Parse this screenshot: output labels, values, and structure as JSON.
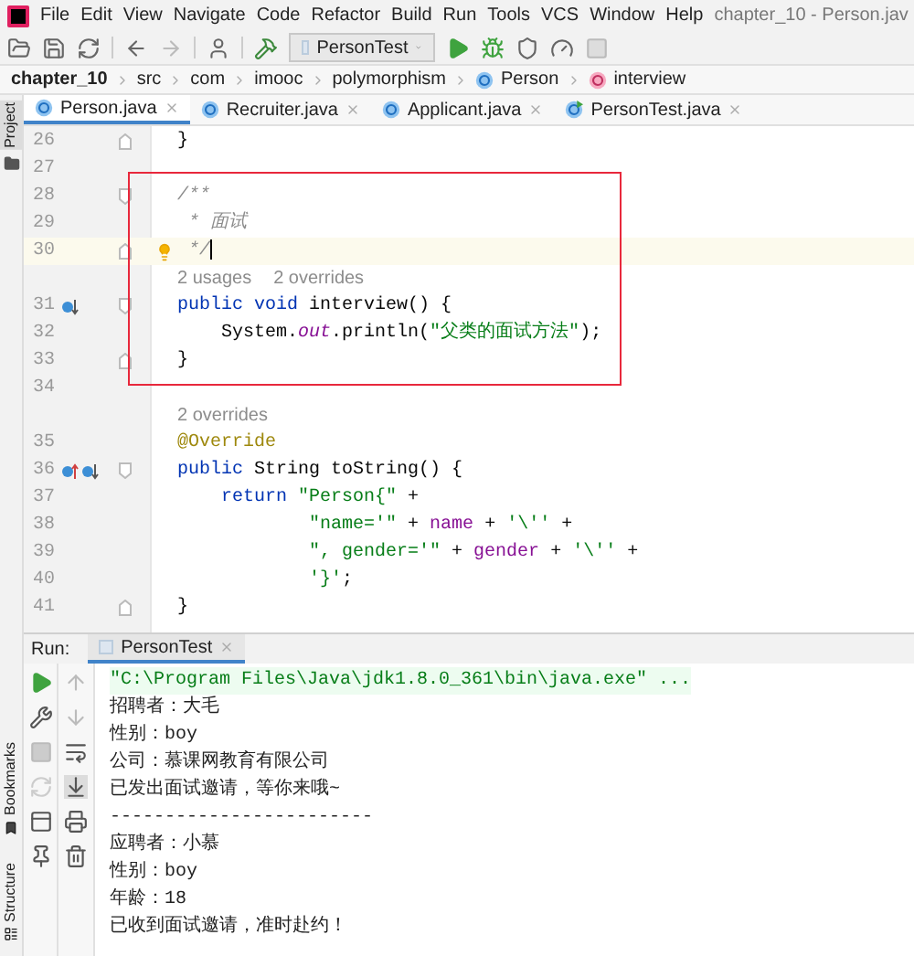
{
  "menu": [
    "File",
    "Edit",
    "View",
    "Navigate",
    "Code",
    "Refactor",
    "Build",
    "Run",
    "Tools",
    "VCS",
    "Window",
    "Help"
  ],
  "window": {
    "title": "chapter_10 - Person.jav"
  },
  "toolbar": {
    "run_config": "PersonTest"
  },
  "breadcrumbs": [
    {
      "label": "chapter_10",
      "kind": "project"
    },
    {
      "label": "src",
      "kind": "folder"
    },
    {
      "label": "com",
      "kind": "folder"
    },
    {
      "label": "imooc",
      "kind": "folder"
    },
    {
      "label": "polymorphism",
      "kind": "folder"
    },
    {
      "label": "Person",
      "kind": "class"
    },
    {
      "label": "interview",
      "kind": "method"
    }
  ],
  "left_strip": {
    "project_label": "Project",
    "bookmarks_label": "Bookmarks",
    "structure_label": "Structure"
  },
  "tabs": [
    {
      "label": "Person.java",
      "selected": true,
      "kind": "class"
    },
    {
      "label": "Recruiter.java",
      "selected": false,
      "kind": "class"
    },
    {
      "label": "Applicant.java",
      "selected": false,
      "kind": "class"
    },
    {
      "label": "PersonTest.java",
      "selected": false,
      "kind": "runnable"
    }
  ],
  "editor": {
    "blocks": [
      {
        "boxed": false,
        "lines": [
          {
            "kind": "code",
            "number": "26",
            "current": false,
            "fold": {
              "kind": "end"
            },
            "tokens": [
              {
                "text": "}",
                "kind": "plain"
              }
            ]
          },
          {
            "kind": "code",
            "number": "27",
            "current": false
          }
        ]
      },
      {
        "boxed": true,
        "lines": [
          {
            "kind": "code",
            "number": "28",
            "current": false,
            "fold": {
              "kind": "start"
            },
            "tokens": [
              {
                "text": "/**",
                "kind": "comment"
              }
            ]
          },
          {
            "kind": "code",
            "number": "29",
            "current": false,
            "tokens": [
              {
                "text": " * 面试",
                "kind": "comment"
              }
            ]
          },
          {
            "kind": "code",
            "number": "30",
            "current": true,
            "bulb": true,
            "fold": {
              "kind": "end"
            },
            "tokens": [
              {
                "text": " */",
                "kind": "comment"
              }
            ]
          },
          {
            "kind": "inlay",
            "parts": [
              "2 usages",
              "2 overrides"
            ]
          },
          {
            "kind": "code",
            "number": "31",
            "current": false,
            "fold": {
              "kind": "start"
            },
            "gutter": [
              {
                "kind": "overridden"
              }
            ],
            "tokens": [
              {
                "text": "public void ",
                "kind": "keyword"
              },
              {
                "text": "interview() {",
                "kind": "plain"
              }
            ]
          },
          {
            "kind": "code",
            "number": "32",
            "current": false,
            "tokens": [
              {
                "text": "    System.",
                "kind": "plain"
              },
              {
                "text": "out",
                "kind": "static"
              },
              {
                "text": ".println(",
                "kind": "plain"
              },
              {
                "text": "\"父类的面试方法\"",
                "kind": "string"
              },
              {
                "text": ");",
                "kind": "plain"
              }
            ]
          },
          {
            "kind": "code",
            "number": "33",
            "current": false,
            "fold": {
              "kind": "end"
            },
            "tokens": [
              {
                "text": "}",
                "kind": "plain"
              }
            ]
          }
        ]
      },
      {
        "boxed": false,
        "lines": [
          {
            "kind": "code",
            "number": "34",
            "current": false
          },
          {
            "kind": "inlay",
            "parts": [
              "2 overrides"
            ]
          },
          {
            "kind": "code",
            "number": "35",
            "current": false,
            "tokens": [
              {
                "text": "@Override",
                "kind": "annotation"
              }
            ]
          },
          {
            "kind": "code",
            "number": "36",
            "current": false,
            "fold": {
              "kind": "start"
            },
            "gutter": [
              {
                "kind": "overrides"
              },
              {
                "kind": "overridden"
              }
            ],
            "tokens": [
              {
                "text": "public ",
                "kind": "keyword"
              },
              {
                "text": "String toString() {",
                "kind": "plain"
              }
            ]
          },
          {
            "kind": "code",
            "number": "37",
            "current": false,
            "tokens": [
              {
                "text": "    return ",
                "kind": "keyword"
              },
              {
                "text": "\"Person{\"",
                "kind": "string"
              },
              {
                "text": " +",
                "kind": "plain"
              }
            ]
          },
          {
            "kind": "code",
            "number": "38",
            "current": false,
            "tokens": [
              {
                "text": "            \"name='\"",
                "kind": "string"
              },
              {
                "text": " + ",
                "kind": "plain"
              },
              {
                "text": "name",
                "kind": "field"
              },
              {
                "text": " + ",
                "kind": "plain"
              },
              {
                "text": "'\\''",
                "kind": "string"
              },
              {
                "text": " +",
                "kind": "plain"
              }
            ]
          },
          {
            "kind": "code",
            "number": "39",
            "current": false,
            "tokens": [
              {
                "text": "            \", gender='\"",
                "kind": "string"
              },
              {
                "text": " + ",
                "kind": "plain"
              },
              {
                "text": "gender",
                "kind": "field"
              },
              {
                "text": " + ",
                "kind": "plain"
              },
              {
                "text": "'\\''",
                "kind": "string"
              },
              {
                "text": " +",
                "kind": "plain"
              }
            ]
          },
          {
            "kind": "code",
            "number": "40",
            "current": false,
            "tokens": [
              {
                "text": "            '}'",
                "kind": "string"
              },
              {
                "text": ";",
                "kind": "plain"
              }
            ]
          },
          {
            "kind": "code",
            "number": "41",
            "current": false,
            "fold": {
              "kind": "end"
            },
            "tokens": [
              {
                "text": "}",
                "kind": "plain"
              }
            ]
          }
        ]
      }
    ]
  },
  "run_panel": {
    "label": "Run:",
    "tab": "PersonTest",
    "console": [
      {
        "kind": "command",
        "text": "\"C:\\Program Files\\Java\\jdk1.8.0_361\\bin\\java.exe\" ..."
      },
      {
        "kind": "output",
        "text": "招聘者：大毛"
      },
      {
        "kind": "output",
        "text": "性别：boy"
      },
      {
        "kind": "output",
        "text": "公司：慕课网教育有限公司"
      },
      {
        "kind": "output",
        "text": "已发出面试邀请，等你来哦~"
      },
      {
        "kind": "output",
        "text": "------------------------"
      },
      {
        "kind": "output",
        "text": "应聘者：小慕"
      },
      {
        "kind": "output",
        "text": "性别：boy"
      },
      {
        "kind": "output",
        "text": "年龄：18"
      },
      {
        "kind": "output",
        "text": "已收到面试邀请，准时赴约！"
      }
    ]
  }
}
